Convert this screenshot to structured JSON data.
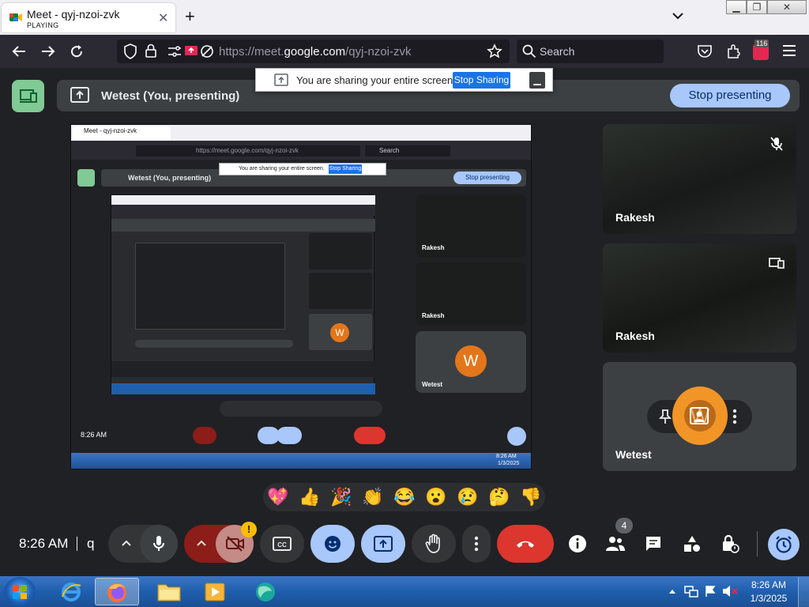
{
  "browser": {
    "tab_title": "Meet - qyj-nzoi-zvk",
    "tab_status": "PLAYING",
    "tab_close": "✕",
    "new_tab": "+",
    "url_prefix": "https://meet.",
    "url_domain": "google.com",
    "url_suffix": "/qyj-nzoi-zvk",
    "search_placeholder": "Search",
    "notification_badge": "116"
  },
  "meet": {
    "presenting_title": "Wetest (You, presenting)",
    "stop_presenting": "Stop presenting",
    "sharing_banner": "You are sharing your entire screen.",
    "stop_sharing": "Stop Sharing",
    "participants": [
      {
        "name": "Rakesh",
        "indicator": "muted-mic-icon"
      },
      {
        "name": "Rakesh",
        "indicator": "presenting-icon"
      },
      {
        "name": "Wetest",
        "avatar_letter": "W",
        "avatar_color": "#f29527"
      }
    ],
    "reactions": [
      "💖",
      "👍",
      "🎉",
      "👏",
      "😂",
      "😮",
      "😢",
      "🤔",
      "👎"
    ],
    "time": "8:26 AM",
    "meeting_code": "q",
    "people_count": "4",
    "camera_warning": "!"
  },
  "nested": {
    "tab_title": "Meet - qyj-nzoi-zvk",
    "url": "https://meet.google.com/qyj-nzoi-zvk",
    "search": "Search",
    "presenting_title": "Wetest (You, presenting)",
    "stop_presenting": "Stop presenting",
    "sharing_banner": "You are sharing your entire screen.",
    "stop_sharing": "Stop Sharing",
    "name1": "Rakesh",
    "name2": "Rakesh",
    "name3": "Wetest",
    "time": "8:26 AM",
    "taskbar_time": "8:26 AM",
    "taskbar_date": "1/3/2025"
  },
  "taskbar": {
    "time": "8:26 AM",
    "date": "1/3/2025"
  },
  "colors": {
    "meet_bg": "#202124",
    "accent_blue": "#a8c7fa",
    "hangup_red": "#dc362e",
    "present_green": "#81c995"
  }
}
